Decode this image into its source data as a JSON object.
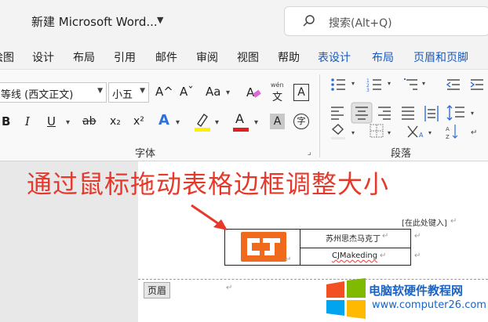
{
  "titlebar": {
    "doc_title": "新建 Microsoft Word...",
    "search_placeholder": "搜索(Alt+Q)"
  },
  "tabs": [
    "绘图",
    "设计",
    "布局",
    "引用",
    "邮件",
    "审阅",
    "视图",
    "帮助",
    "表设计",
    "布局",
    "页眉和页脚"
  ],
  "ribbon": {
    "font_name": "等线 (西文正文)",
    "font_size": "小五",
    "grow_font": "A^",
    "shrink_font": "Aˇ",
    "change_case": "Aa",
    "phonetic_top": "wén",
    "phonetic_char": "文",
    "char_border": "A",
    "bold": "B",
    "italic": "I",
    "underline": "U",
    "strike": "ab",
    "subscript": "x₂",
    "superscript": "x²",
    "text_effect": "A",
    "font_color": "A",
    "char_shade": "A",
    "enclose_char": "字",
    "font_group": "字体",
    "paragraph_group": "段落",
    "dialog_launcher": "⌟"
  },
  "document": {
    "headline": "通过鼠标拖动表格边框调整大小",
    "type_here": "[在此处键入]",
    "cell_company": "苏州思杰马克丁",
    "cell_brand": "CJMakeding",
    "header_tag": "页眉",
    "para_mark": "↵",
    "logo_letters": "CJ"
  },
  "watermark": {
    "title": "电脑软硬件教程网",
    "url": "www.computer26.com"
  },
  "colors": {
    "headline": "#e6392b",
    "highlight": "#ffef00",
    "font_color": "#e02020",
    "logo": "#f06a1e",
    "ctx_tab": "#185abd"
  }
}
